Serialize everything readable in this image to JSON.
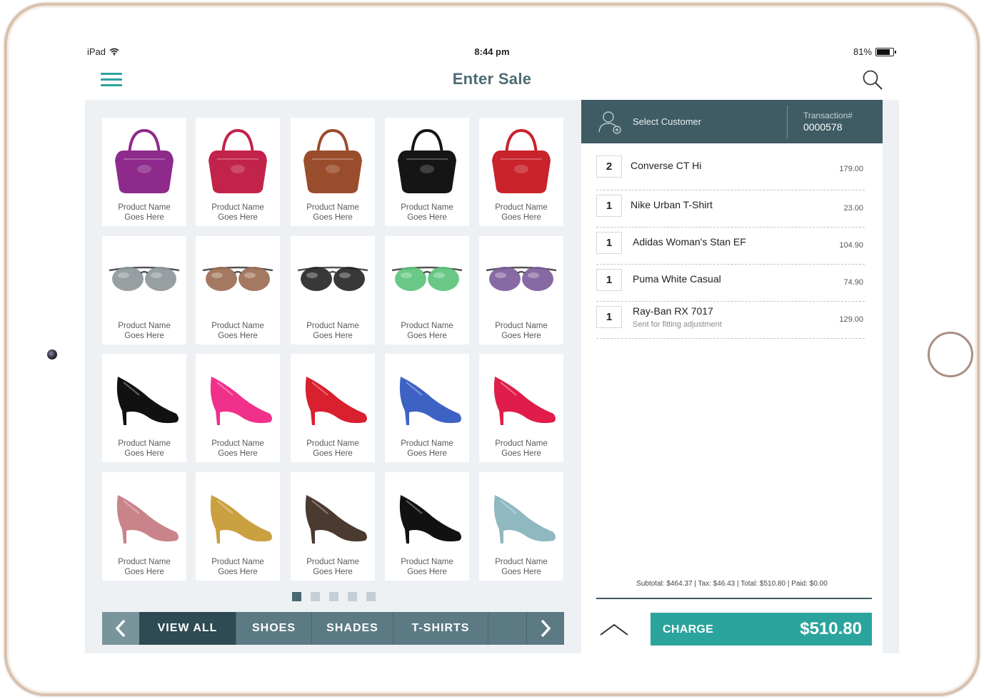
{
  "statusbar": {
    "device": "iPad",
    "time": "8:44 pm",
    "battery": "81%",
    "battery_level": 0.81
  },
  "navbar": {
    "title": "Enter Sale",
    "menu_icon": "hamburger-menu-icon",
    "search_icon": "search-icon"
  },
  "colors": {
    "accent": "#2aa49d",
    "header_dark": "#3f5b64",
    "title": "#4d6b74",
    "background": "#eef1f4"
  },
  "products": [
    {
      "line1": "Product Name",
      "line2": "Goes Here",
      "kind": "bag",
      "color": "#8e2a8c"
    },
    {
      "line1": "Product Name",
      "line2": "Goes Here",
      "kind": "bag",
      "color": "#c2234a"
    },
    {
      "line1": "Product Name",
      "line2": "Goes Here",
      "kind": "bag",
      "color": "#9a4d2c"
    },
    {
      "line1": "Product Name",
      "line2": "Goes Here",
      "kind": "bag",
      "color": "#151515"
    },
    {
      "line1": "Product Name",
      "line2": "Goes Here",
      "kind": "bag",
      "color": "#c9232b"
    },
    {
      "line1": "Product Name",
      "line2": "Goes Here",
      "kind": "glasses",
      "color": "#8c9598"
    },
    {
      "line1": "Product Name",
      "line2": "Goes Here",
      "kind": "glasses",
      "color": "#9a6a50"
    },
    {
      "line1": "Product Name",
      "line2": "Goes Here",
      "kind": "glasses",
      "color": "#222222"
    },
    {
      "line1": "Product Name",
      "line2": "Goes Here",
      "kind": "glasses",
      "color": "#5ac27a"
    },
    {
      "line1": "Product Name",
      "line2": "Goes Here",
      "kind": "glasses",
      "color": "#7a5a9a"
    },
    {
      "line1": "Product Name",
      "line2": "Goes Here",
      "kind": "heel",
      "color": "#111111"
    },
    {
      "line1": "Product Name",
      "line2": "Goes Here",
      "kind": "heel",
      "color": "#f0308a"
    },
    {
      "line1": "Product Name",
      "line2": "Goes Here",
      "kind": "heel",
      "color": "#d8202e"
    },
    {
      "line1": "Product Name",
      "line2": "Goes Here",
      "kind": "heel",
      "color": "#3e62c4"
    },
    {
      "line1": "Product Name",
      "line2": "Goes Here",
      "kind": "heel",
      "color": "#e01d4a"
    },
    {
      "line1": "Product Name",
      "line2": "Goes Here",
      "kind": "heel",
      "color": "#c9848a"
    },
    {
      "line1": "Product Name",
      "line2": "Goes Here",
      "kind": "heel",
      "color": "#caa040"
    },
    {
      "line1": "Product Name",
      "line2": "Goes Here",
      "kind": "heel",
      "color": "#4a3a30"
    },
    {
      "line1": "Product Name",
      "line2": "Goes Here",
      "kind": "heel",
      "color": "#111111"
    },
    {
      "line1": "Product Name",
      "line2": "Goes Here",
      "kind": "heel",
      "color": "#8fb8c0"
    }
  ],
  "pager": {
    "pages": 5,
    "current": 1
  },
  "categories": {
    "tabs": [
      {
        "label": "VIEW ALL",
        "active": true
      },
      {
        "label": "SHOES",
        "active": false
      },
      {
        "label": "SHADES",
        "active": false
      },
      {
        "label": "T-SHIRTS",
        "active": false
      },
      {
        "label": "",
        "active": false
      }
    ],
    "prev_icon": "chevron-left-icon",
    "next_icon": "chevron-right-icon"
  },
  "sale": {
    "customer_label": "Select Customer",
    "customer_icon": "add-customer-icon",
    "transaction_label": "Transaction#",
    "transaction_number": "0000578",
    "items": [
      {
        "qty": "2",
        "name": "Converse CT Hi",
        "note": "",
        "price": "179.00"
      },
      {
        "qty": "1",
        "name": "Nike Urban T-Shirt",
        "note": "",
        "price": "23.00"
      },
      {
        "qty": "1",
        "name": "Adidas Woman's Stan EF",
        "note": "",
        "price": "104.90"
      },
      {
        "qty": "1",
        "name": "Puma White Casual",
        "note": "",
        "price": "74.90"
      },
      {
        "qty": "1",
        "name": "Ray-Ban RX 7017",
        "note": "Sent for fitting adjustment",
        "price": "129.00"
      }
    ],
    "totals": "Subtotal: $464.37 |  Tax: $46.43 | Total: $510.80  |  Paid: $0.00",
    "expand_icon": "chevron-up-icon",
    "charge_label": "CHARGE",
    "charge_amount": "$510.80"
  }
}
